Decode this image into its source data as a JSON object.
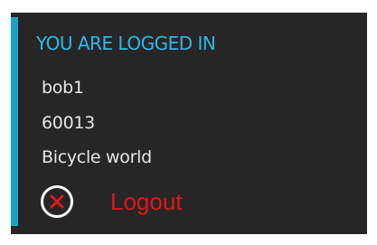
{
  "login_panel": {
    "heading": "YOU ARE LOGGED IN",
    "username": "bob1",
    "user_id": "60013",
    "store_name": "Bicycle world",
    "logout": {
      "label": "Logout",
      "icon": "close-circle-icon"
    }
  },
  "colors": {
    "panel_background": "#262626",
    "accent": "#1aa3c9",
    "heading": "#2fb8e6",
    "text": "#e6e6e6",
    "logout": "#e0161b"
  }
}
